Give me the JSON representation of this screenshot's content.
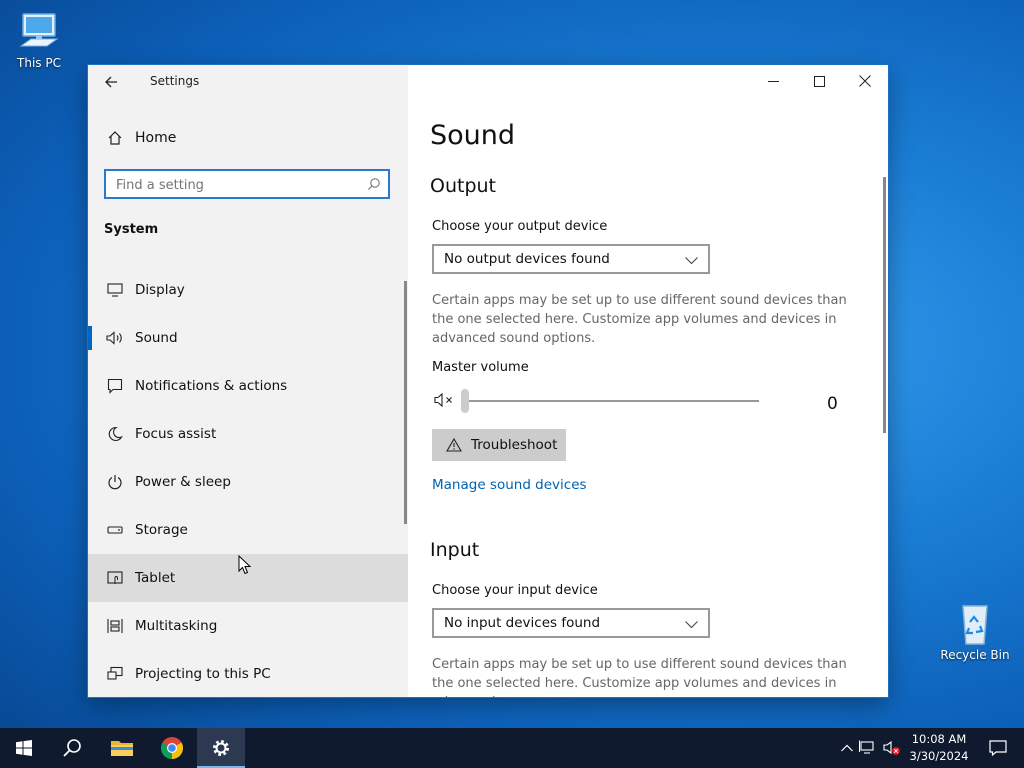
{
  "desktop": {
    "this_pc_label": "This PC",
    "recycle_bin_label": "Recycle Bin"
  },
  "window": {
    "app_title": "Settings",
    "controls": {
      "minimize": "—",
      "maximize": "☐",
      "close": "✕"
    }
  },
  "sidebar": {
    "home_label": "Home",
    "search_placeholder": "Find a setting",
    "group_label": "System",
    "items": [
      {
        "label": "Display",
        "icon": "monitor-icon"
      },
      {
        "label": "Sound",
        "icon": "speaker-icon",
        "active": true
      },
      {
        "label": "Notifications & actions",
        "icon": "notification-icon"
      },
      {
        "label": "Focus assist",
        "icon": "moon-icon"
      },
      {
        "label": "Power & sleep",
        "icon": "power-icon"
      },
      {
        "label": "Storage",
        "icon": "storage-icon"
      },
      {
        "label": "Tablet",
        "icon": "tablet-icon",
        "hover": true
      },
      {
        "label": "Multitasking",
        "icon": "multitasking-icon"
      },
      {
        "label": "Projecting to this PC",
        "icon": "projecting-icon"
      }
    ]
  },
  "content": {
    "page_title": "Sound",
    "output": {
      "heading": "Output",
      "device_label": "Choose your output device",
      "device_value": "No output devices found",
      "description": "Certain apps may be set up to use different sound devices than the one selected here. Customize app volumes and devices in advanced sound options.",
      "master_volume_label": "Master volume",
      "volume_value": "0",
      "volume_level": 0,
      "troubleshoot_label": "Troubleshoot",
      "manage_link": "Manage sound devices"
    },
    "input": {
      "heading": "Input",
      "device_label": "Choose your input device",
      "device_value": "No input devices found",
      "description": "Certain apps may be set up to use different sound devices than the one selected here. Customize app volumes and devices in advanced"
    }
  },
  "taskbar": {
    "time": "10:08 AM",
    "date": "3/30/2024"
  },
  "colors": {
    "accent": "#0067c0",
    "link": "#0063b1",
    "taskbar": "#0f1a2e"
  }
}
